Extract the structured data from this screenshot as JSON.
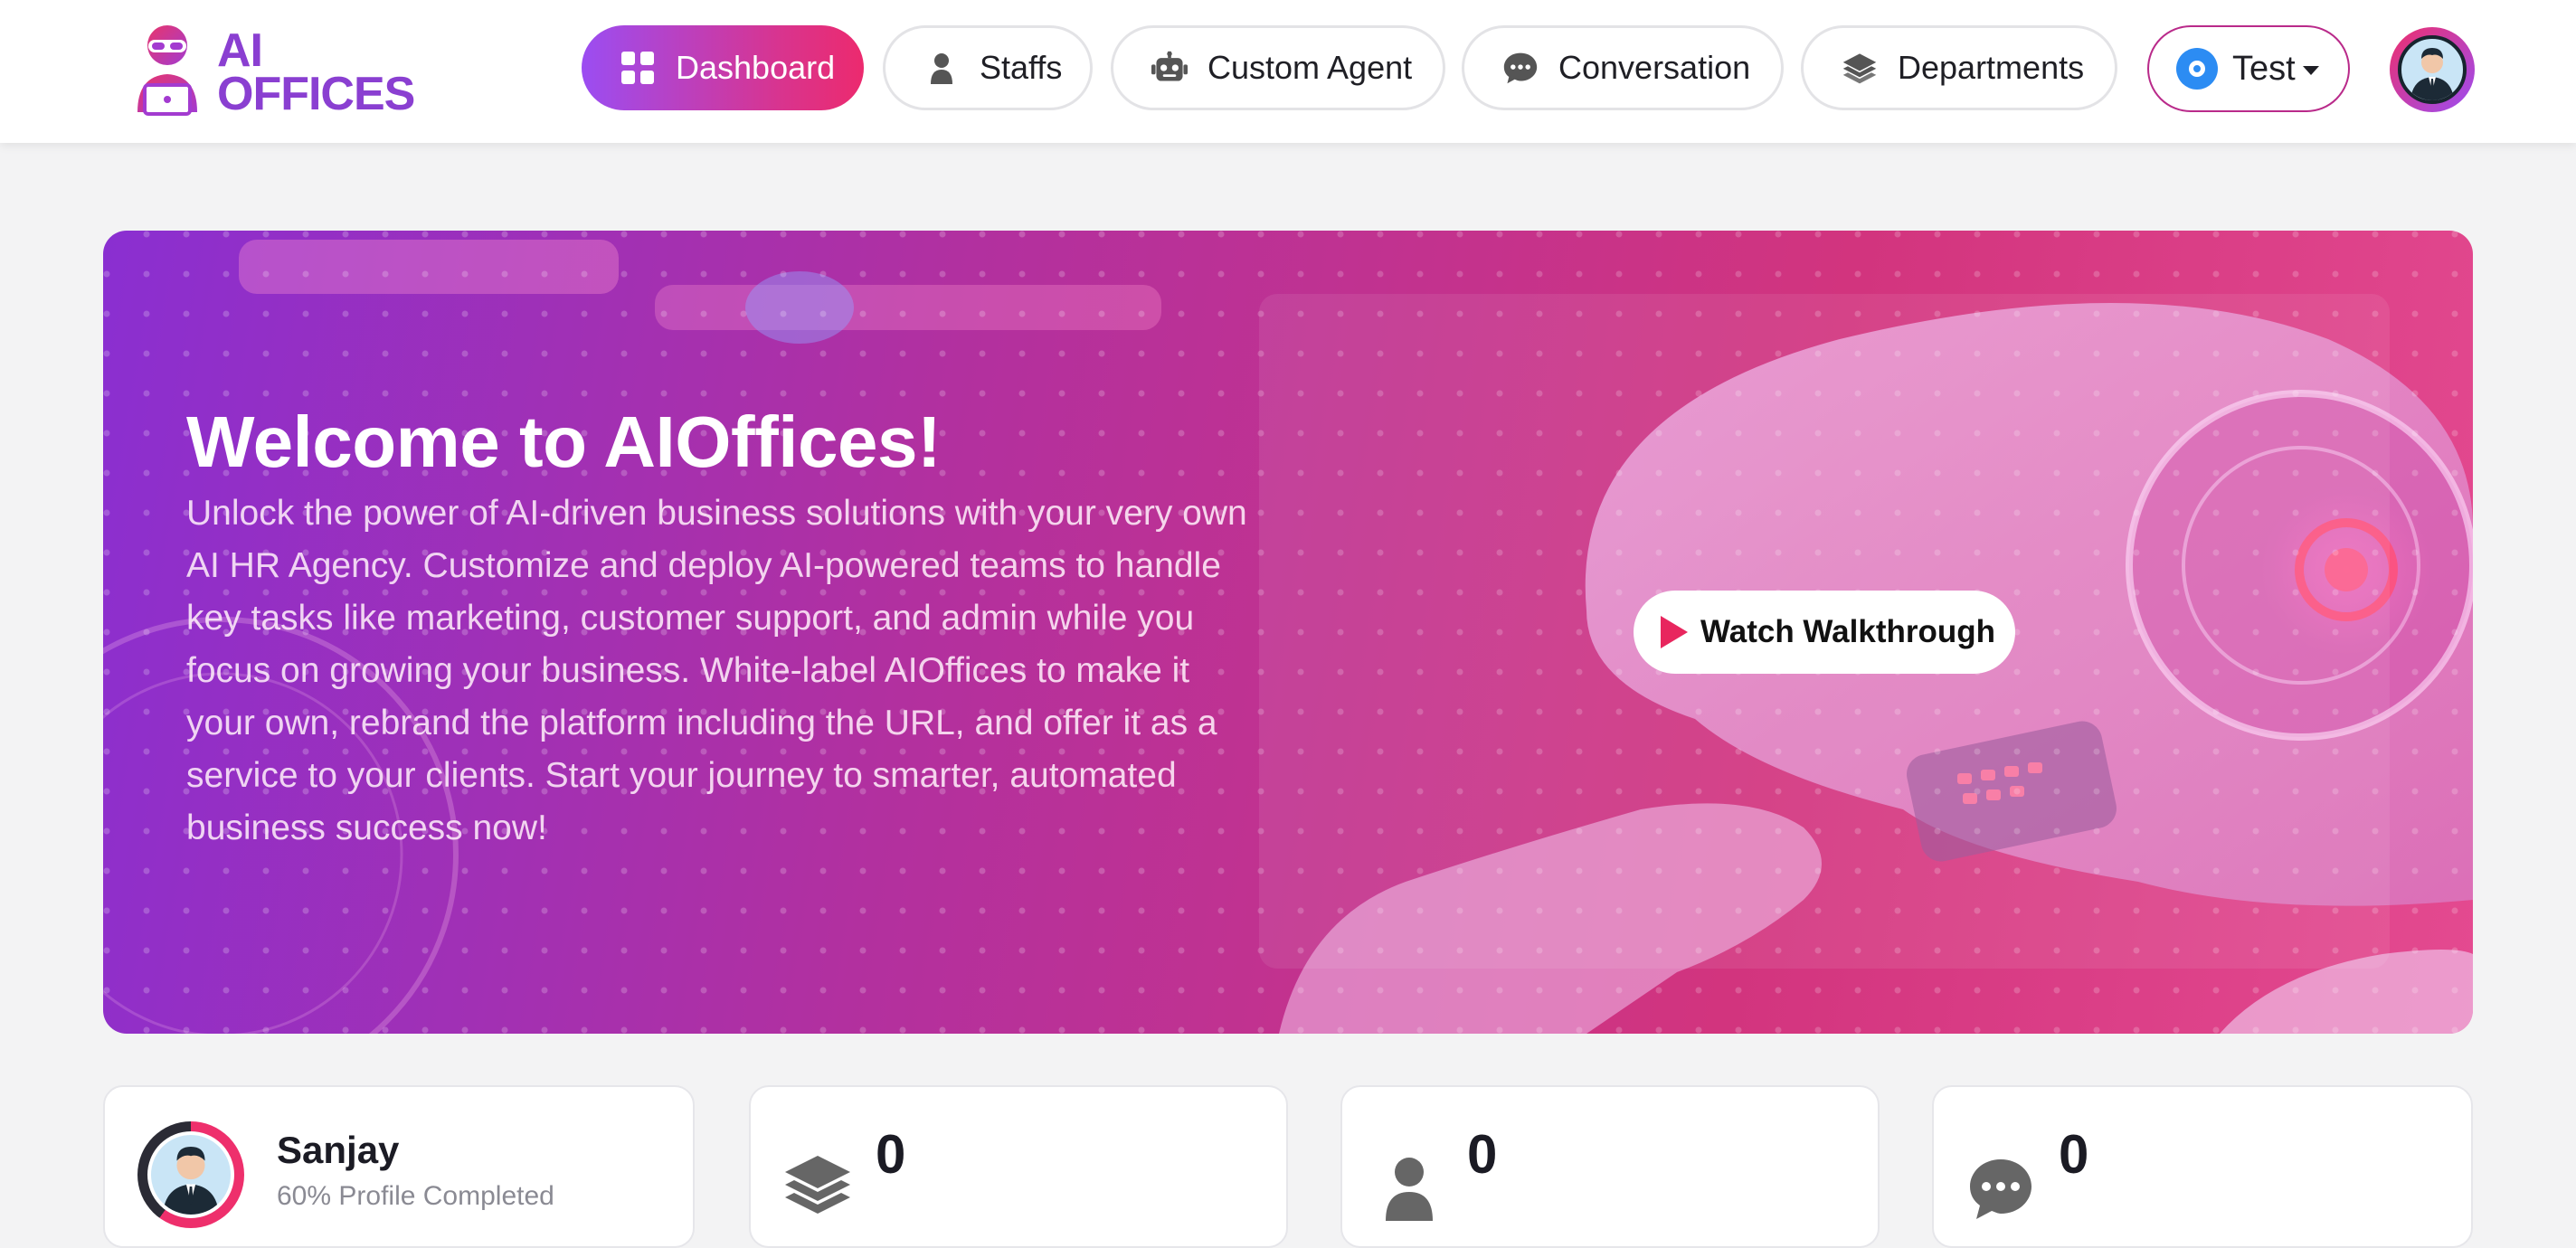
{
  "brand": {
    "line1": "AI",
    "line2": "OFFICES",
    "color": "#8a3fd1"
  },
  "nav": {
    "items": [
      {
        "label": "Dashboard",
        "icon": "grid-icon",
        "active": true
      },
      {
        "label": "Staffs",
        "icon": "person-icon",
        "active": false
      },
      {
        "label": "Custom Agent",
        "icon": "robot-icon",
        "active": false
      },
      {
        "label": "Conversation",
        "icon": "chat-icon",
        "active": false
      },
      {
        "label": "Departments",
        "icon": "layers-icon",
        "active": false
      }
    ],
    "workspace": {
      "label": "Test",
      "icon": "workspace-icon"
    },
    "accent_gradient": [
      "#9b4df2",
      "#ec2a6e"
    ]
  },
  "hero": {
    "title": "Welcome to AIOffices!",
    "text": "Unlock the power of AI-driven business solutions with your very own AI HR Agency. Customize and deploy AI-powered teams to handle key tasks like marketing, customer support, and admin while you focus on growing your business. White-label AIOffices to make it your own, rebrand the platform including the URL, and offer it as a service to your clients. Start your journey to smarter, automated business success now!",
    "button_label": "Watch Walkthrough"
  },
  "cards": {
    "profile": {
      "name": "Sanjay",
      "subtitle": "60% Profile Completed"
    },
    "stats": [
      {
        "value": "0",
        "icon": "layers-icon"
      },
      {
        "value": "0",
        "icon": "person-icon"
      },
      {
        "value": "0",
        "icon": "chat-icon"
      }
    ]
  }
}
